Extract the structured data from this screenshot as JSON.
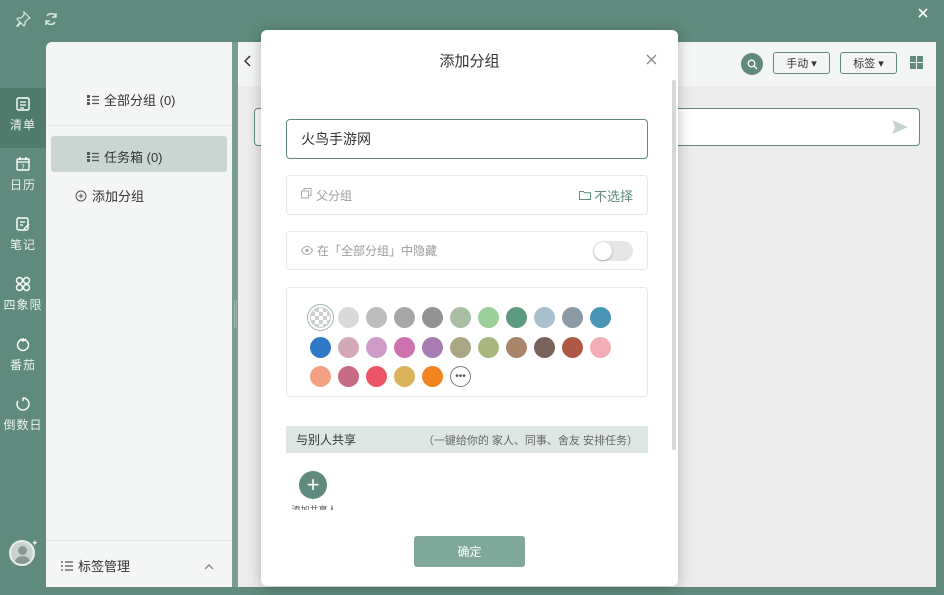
{
  "window": {
    "pin_icon": "pin-icon",
    "sync_icon": "sync-icon",
    "close_icon": "close-icon"
  },
  "rail": [
    {
      "label": "清单",
      "icon": "list-icon"
    },
    {
      "label": "日历",
      "icon": "calendar-icon"
    },
    {
      "label": "笔记",
      "icon": "note-icon"
    },
    {
      "label": "四象限",
      "icon": "quadrant-icon"
    },
    {
      "label": "番茄",
      "icon": "tomato-icon"
    },
    {
      "label": "倒数日",
      "icon": "countdown-icon"
    }
  ],
  "sidebar": {
    "all_groups": "全部分组 (0)",
    "inbox": "任务箱 (0)",
    "add_group": "添加分组",
    "tag_manage": "标签管理"
  },
  "toolbar": {
    "sort_label": "手动",
    "tag_label": "标签"
  },
  "dialog": {
    "title": "添加分组",
    "name_value": "火鸟手游网",
    "parent_label": "父分组",
    "parent_value": "不选择",
    "hide_label": "在「全部分组」中隐藏",
    "hide_enabled": false,
    "share_label": "与别人共享",
    "share_hint": "（一键给你的 家人、同事、舍友 安排任务）",
    "add_person_label": "添加共享人",
    "confirm_label": "确定"
  },
  "colors": [
    "transparent",
    "#d9d9d9",
    "#bdbdbd",
    "#a6a6a6",
    "#939393",
    "#a9bea5",
    "#9bd09a",
    "#5d9b80",
    "#a8c0d0",
    "#8b9aa5",
    "#4a95b5",
    "#2f79c6",
    "#d3a9b8",
    "#cd9cc8",
    "#cf72b0",
    "#a67cb2",
    "#a9a683",
    "#a9b77f",
    "#a9856a",
    "#7a635a",
    "#ad5845",
    "#f1afb5",
    "#f2a282",
    "#c76a83",
    "#ec5566",
    "#dbb35d",
    "#ef8420",
    "more"
  ],
  "accent": "#5f8a7d"
}
